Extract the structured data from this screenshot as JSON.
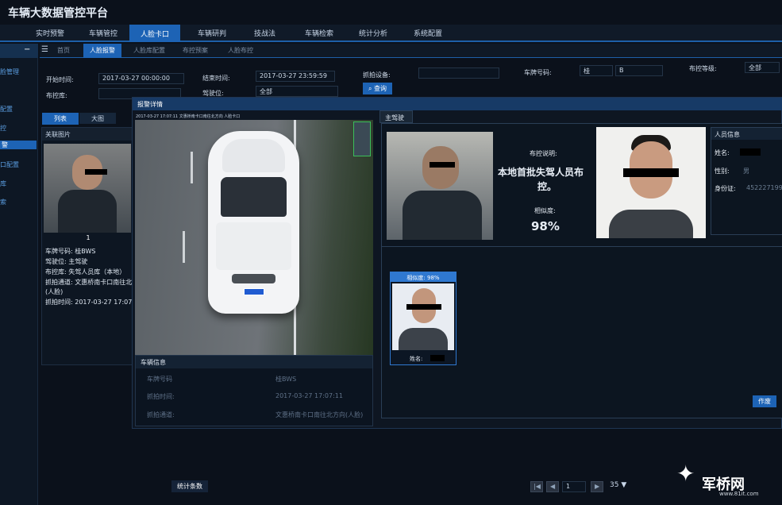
{
  "app": {
    "title": "车辆大数据管控平台"
  },
  "topnav": {
    "items": [
      "实时预警",
      "车辆管控",
      "人脸卡口",
      "车辆研判",
      "技战法",
      "车辆检索",
      "统计分析",
      "系统配置"
    ],
    "active": "人脸卡口"
  },
  "tabs": {
    "items": [
      "首页",
      "人脸报警",
      "人脸库配置",
      "布控预案",
      "人脸布控"
    ],
    "active": "人脸报警"
  },
  "sidebar": {
    "items": [
      "脸管理",
      "配置",
      "控",
      "警",
      "口配置",
      "库",
      "索"
    ],
    "active": "警"
  },
  "filters": {
    "start_label": "开始时间:",
    "start_value": "2017-03-27 00:00:00",
    "end_label": "结束时间:",
    "end_value": "2017-03-27 23:59:59",
    "device_label": "抓拍设备:",
    "device_value": "",
    "plate_label": "车牌号码:",
    "plate_prefix": "桂",
    "plate_value": "B",
    "level_label": "布控等级:",
    "level_value": "全部",
    "lib_label": "布控库:",
    "lib_value": "",
    "seat_label": "驾驶位:",
    "seat_value": "全部",
    "search_button": "查询"
  },
  "viewtabs": {
    "list": "列表",
    "big": "大图"
  },
  "leftpanel": {
    "header": "关联图片",
    "index": "1",
    "plate": "车牌号码: 桂BWS",
    "seat": "驾驶位: 主驾驶",
    "lib": "布控库: 失驾人员库（本地）",
    "channel1": "抓拍通道: 文惠桥南卡口南往北",
    "channel2": "(人脸)",
    "time": "抓拍时间: 2017-03-27 17:07:"
  },
  "modal": {
    "title": "报警详情",
    "overlay_text": "2017-03-27 17:07:11 文惠桥南卡口南往北方向 人脸卡口",
    "vehicle_info": {
      "header": "车辆信息",
      "plate_label": "车牌号码",
      "plate_value": "桂BWS",
      "time_label": "抓拍时间:",
      "time_value": "2017-03-27 17:07:11",
      "channel_label": "抓拍通道:",
      "channel_value": "文惠桥南卡口南往北方向(人脸)"
    },
    "tab": "主驾驶",
    "desc_label": "布控说明:",
    "desc_text1": "本地首批失驾人员布",
    "desc_text2": "控。",
    "sim_label": "相似度:",
    "sim_value": "98%",
    "person": {
      "header": "人员信息",
      "name_label": "姓名:",
      "gender_label": "性别:",
      "gender_value": "男",
      "id_label": "身份证:",
      "id_value": "452227199"
    },
    "match": {
      "sim": "相似度: 98%",
      "name": "姓名:"
    },
    "action_button": "作废"
  },
  "footer": {
    "stat": "统计条数",
    "page": "1",
    "total": "35 ▼"
  },
  "watermark": {
    "text": "军桥网",
    "url": "www.81it.com"
  }
}
